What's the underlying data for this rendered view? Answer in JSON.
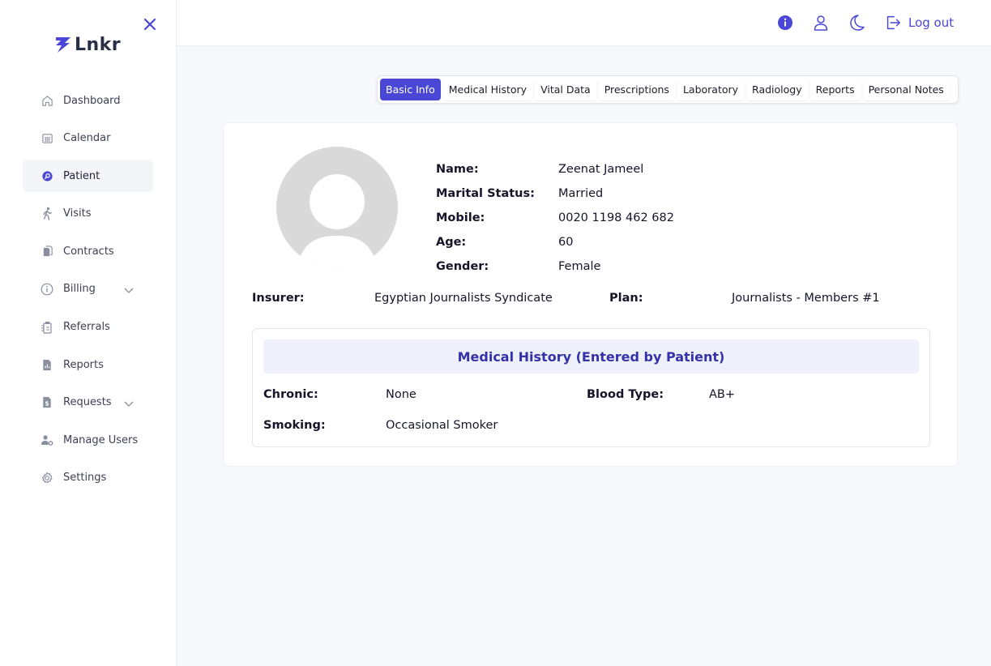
{
  "brand": {
    "logo_text": "Lnkr"
  },
  "sidebar": {
    "items": [
      {
        "label": "Dashboard",
        "icon": "home-icon"
      },
      {
        "label": "Calendar",
        "icon": "calendar-icon"
      },
      {
        "label": "Patient",
        "icon": "patient-search-icon",
        "active": true
      },
      {
        "label": "Visits",
        "icon": "walking-icon"
      },
      {
        "label": "Contracts",
        "icon": "documents-icon"
      },
      {
        "label": "Billing",
        "icon": "info-circle-icon",
        "expandable": true
      },
      {
        "label": "Referrals",
        "icon": "referrals-icon"
      },
      {
        "label": "Reports",
        "icon": "report-icon"
      },
      {
        "label": "Requests",
        "icon": "request-icon",
        "expandable": true
      },
      {
        "label": "Manage Users",
        "icon": "users-gear-icon"
      },
      {
        "label": "Settings",
        "icon": "gear-icon"
      }
    ]
  },
  "header": {
    "icons": [
      "info-icon",
      "user-icon",
      "moon-icon"
    ],
    "logout_label": "Log out"
  },
  "tabs": [
    {
      "label": "Basic Info",
      "active": true
    },
    {
      "label": "Medical History"
    },
    {
      "label": "Vital Data"
    },
    {
      "label": "Prescriptions"
    },
    {
      "label": "Laboratory"
    },
    {
      "label": "Radiology"
    },
    {
      "label": "Reports"
    },
    {
      "label": "Personal Notes"
    }
  ],
  "patient": {
    "fields": [
      {
        "label": "Name:",
        "value": "Zeenat Jameel"
      },
      {
        "label": "Marital Status:",
        "value": "Married"
      },
      {
        "label": "Mobile:",
        "value": "0020 1198 462 682"
      },
      {
        "label": "Age:",
        "value": "60"
      },
      {
        "label": "Gender:",
        "value": "Female"
      }
    ],
    "insurer_label": "Insurer:",
    "insurer_value": "Egyptian Journalists Syndicate",
    "plan_label": "Plan:",
    "plan_value": "Journalists - Members #1"
  },
  "medical_history": {
    "title": "Medical History (Entered by Patient)",
    "chronic_label": "Chronic:",
    "chronic_value": "None",
    "blood_label": "Blood Type:",
    "blood_value": "AB+",
    "smoking_label": "Smoking:",
    "smoking_value": "Occasional Smoker"
  },
  "colors": {
    "accent": "#4b47d6",
    "title": "#3531a8",
    "title_bg": "#eef1fc"
  }
}
